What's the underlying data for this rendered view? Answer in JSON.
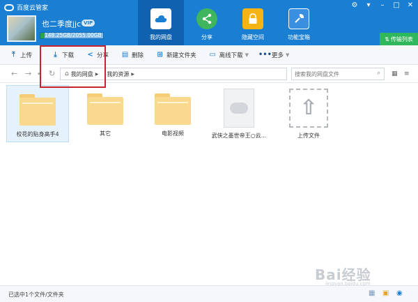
{
  "app": {
    "title": "百度云管家"
  },
  "user": {
    "name": "也二季度jjc",
    "vip": "VIP",
    "storage": "148.25GB/2055.00GB",
    "storage_used_fraction": 0.072
  },
  "nav": [
    {
      "label": "我的网盘",
      "icon": "cloud-icon",
      "color": "#ffffff"
    },
    {
      "label": "分享",
      "icon": "share-icon",
      "color": "#3fb55d"
    },
    {
      "label": "隐藏空间",
      "icon": "lock-icon",
      "color": "#f5b316"
    },
    {
      "label": "功能宝箱",
      "icon": "wrench-icon",
      "color": "#3a8fe0"
    }
  ],
  "transfer_label": "传输列表",
  "toolbar": {
    "upload": "上传",
    "download": "下载",
    "share": "分享",
    "delete": "删除",
    "new_folder": "新建文件夹",
    "offline_download": "离线下载",
    "more": "更多"
  },
  "breadcrumb": [
    "我的网盘",
    "我的资源"
  ],
  "search": {
    "placeholder": "搜索我的网盘文件"
  },
  "files": [
    {
      "name": "校花的贴身高手4",
      "type": "folder",
      "selected": true
    },
    {
      "name": "其它",
      "type": "folder",
      "selected": false
    },
    {
      "name": "电影视频",
      "type": "folder",
      "selected": false
    },
    {
      "name": "武侠之墨世帝王○云...",
      "type": "file",
      "selected": false
    },
    {
      "name": "上传文件",
      "type": "upload",
      "selected": false
    }
  ],
  "status": {
    "text": "已选中1个文件/文件夹"
  },
  "watermark": {
    "main": "Bai经验",
    "sub": "jingyan.baidu.com"
  }
}
